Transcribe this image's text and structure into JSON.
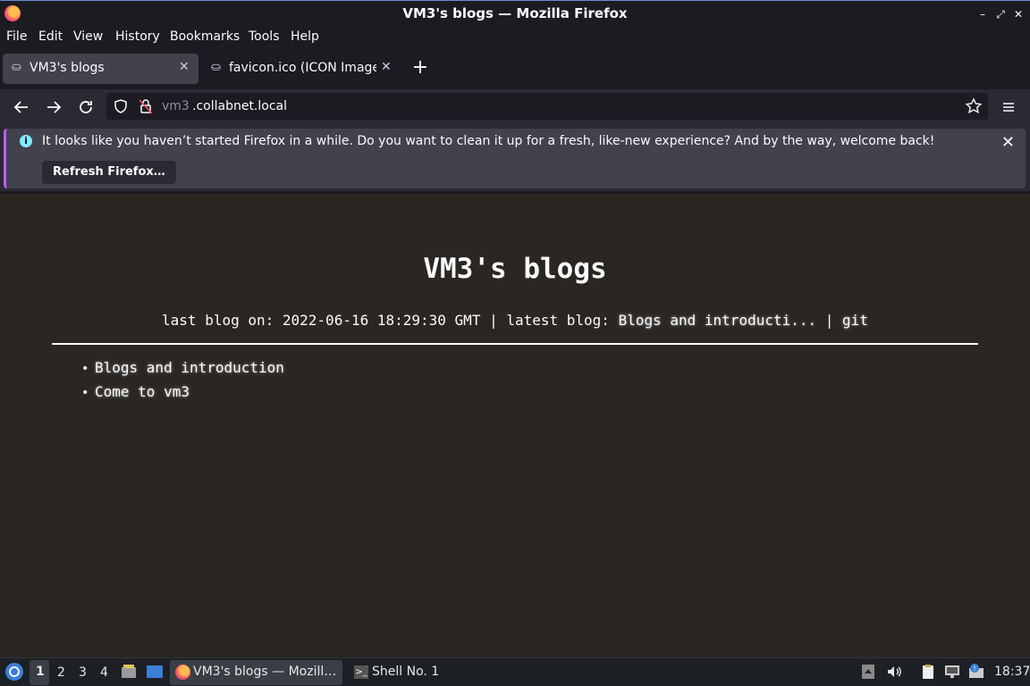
{
  "window": {
    "title": "VM3's blogs — Mozilla Firefox",
    "controls": [
      "–",
      "⤢",
      "✕"
    ]
  },
  "menu": [
    "File",
    "Edit",
    "View",
    "History",
    "Bookmarks",
    "Tools",
    "Help"
  ],
  "tabs": [
    {
      "label": "VM3's blogs",
      "active": true,
      "icon": "page-icon"
    },
    {
      "label": "favicon.ico (ICON Image,",
      "active": false,
      "icon": "page-icon"
    }
  ],
  "nav": {
    "url_prefix": "vm3",
    "url_domain": ".collabnet.local"
  },
  "notification": {
    "message": "It looks like you haven’t started Firefox in a while. Do you want to clean it up for a fresh, like-new experience? And by the way, welcome back!",
    "button_label": "Refresh Firefox…"
  },
  "page": {
    "heading": "VM3's blogs",
    "meta_prefix": "last blog on: 2022-06-16 18:29:30 GMT | latest blog: ",
    "meta_latest_link": "Blogs and introducti...",
    "meta_sep": " | ",
    "meta_git_link": "git",
    "posts": [
      "Blogs and introduction",
      "Come to vm3"
    ]
  },
  "taskbar": {
    "workspaces": [
      "1",
      "2",
      "3",
      "4"
    ],
    "tasks": [
      {
        "label": "VM3's blogs — Mozill…",
        "active": true
      },
      {
        "label": "Shell No. 1",
        "active": false
      }
    ],
    "clock": "18:37"
  }
}
